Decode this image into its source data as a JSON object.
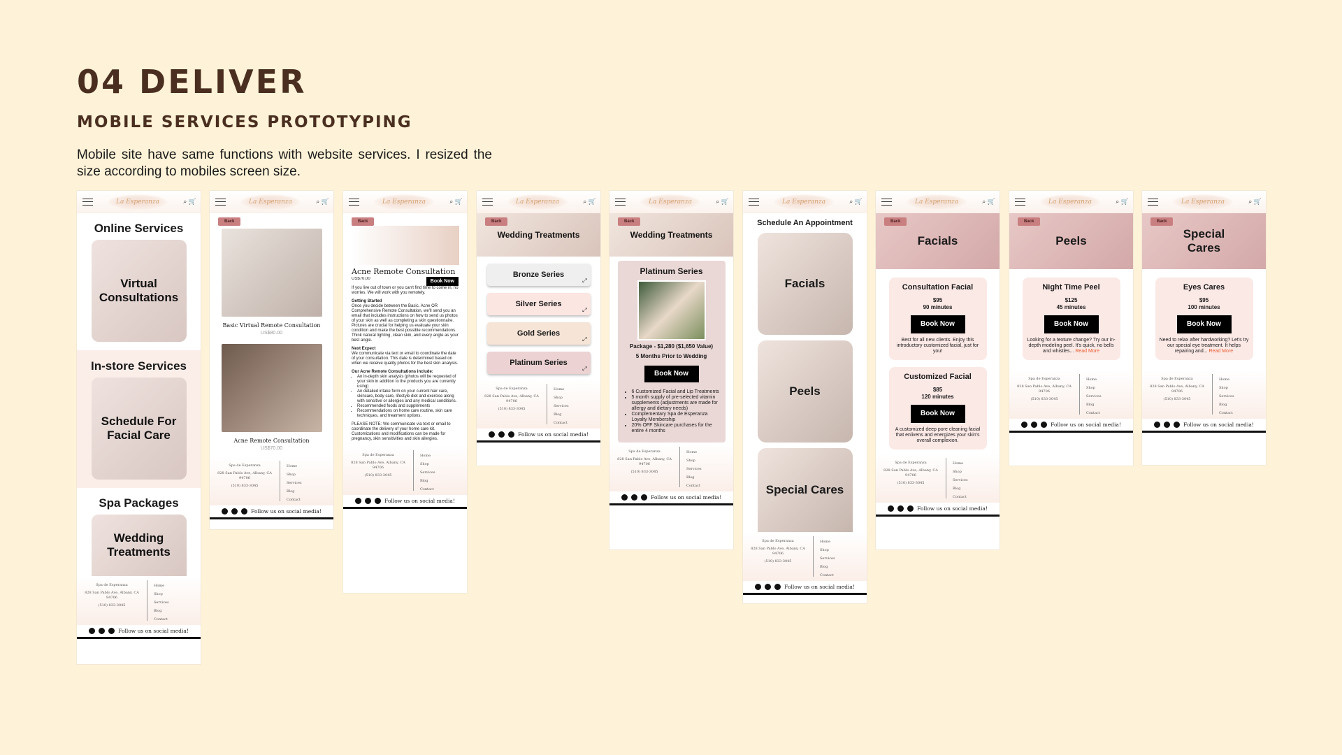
{
  "title": "04 DELIVER",
  "subtitle": "MOBILE SERVICES PROTOTYPING",
  "description": "Mobile site have same functions with website services. I resized the size according to mobiles screen size.",
  "common": {
    "logo": "La Esperanza",
    "back": "Back",
    "book_now": "Book Now",
    "footer_name": "Spa de Esperanza",
    "footer_addr": "828 San Pablo Ave, Albany, CA 94706",
    "footer_phone": "(510) 833-3045",
    "links": [
      "Home",
      "Shop",
      "Services",
      "Blog",
      "Contact"
    ],
    "social": "Follow us on social media!",
    "read_more": "Read More"
  },
  "p1": {
    "s1": "Online Services",
    "c1": "Virtual Consultations",
    "s2": "In-store Services",
    "c2": "Schedule For Facial Care",
    "s3": "Spa Packages",
    "c3": "Wedding Treatments"
  },
  "p2": {
    "cap1": "Basic Virtual Remote Consultation",
    "price1": "US$80.00",
    "cap2": "Acne Remote Consultation",
    "price2": "US$70.00"
  },
  "p3": {
    "title": "Acne Remote Consultation",
    "price": "US$70.00",
    "intro": "If you live out of town or you can't find time to come in, no worries. We will work with you remotely.",
    "h1": "Getting Started",
    "b1": "Once you decide between the Basic, Acne OR Comprehensive Remote Consultation, we'll send you an email that includes instructions on how to send us photos of your skin as well as completing a skin questionnaire. Pictures are crucial for helping us evaluate your skin condition and make the best possible recommendations. Think natural lighting, clean skin, and every angle as your best angle.",
    "h2": "Next Expect",
    "b2": "We communicate via text or email to coordinate the date of your consultation. This date is determined based on when we receive quality photos for the best skin analysis.",
    "h3": "Our Acne Remote Consultations include:",
    "items": [
      "An in-depth skin analysis (photos will be requested of your skin in addition to the products you are currently using)",
      "An detailed intake form on your current hair care, skincare, body care, lifestyle diet and exercise along with sensitive or allergies and any medical conditions.",
      "Recommended foods and supplements",
      "Recommendations on home care routine, skin care techniques, and treatment options."
    ],
    "note": "PLEASE NOTE: We communicate via text or email to coordinate the delivery of your home care kit. Customizations and modifications can be made for pregnancy, skin sensitivities and skin allergies."
  },
  "p4": {
    "banner": "Wedding Treatments",
    "series": [
      {
        "label": "Bronze Series",
        "color": "#efefef"
      },
      {
        "label": "Silver Series",
        "color": "#fbe6e2"
      },
      {
        "label": "Gold Series",
        "color": "#f6e4d6"
      },
      {
        "label": "Platinum Series",
        "color": "#ecd2d2"
      }
    ]
  },
  "p5": {
    "banner": "Wedding Treatments",
    "title": "Platinum Series",
    "package": "Package - $1,280  ($1,650 Value)",
    "timing": "5 Months Prior to Wedding",
    "items": [
      "6 Customized Facial and Lip Treatments",
      "5 month supply of pre-selected vitamin supplements (adjustments are made for allergy and dietary needs)",
      "Complementary Spa de Esperanza Loyalty Membership",
      "20% OFF Skincare purchases for the entire 4 months"
    ]
  },
  "p6": {
    "heading": "Schedule An Appointment",
    "cats": [
      "Facials",
      "Peels",
      "Special Cares"
    ]
  },
  "p7": {
    "banner": "Facials",
    "svcs": [
      {
        "name": "Consultation Facial",
        "price": "$95",
        "dur": "90 minutes",
        "desc": "Best for all new clients. Enjoy this introductory customized facial, just for you!"
      },
      {
        "name": "Customized Facial",
        "price": "$85",
        "dur": "120 minutes",
        "desc": "A customized deep pore cleaning facial that enlivens and energizes your skin's overall complexion."
      }
    ]
  },
  "p8": {
    "banner": "Peels",
    "name": "Night Time Peel",
    "price": "$125",
    "dur": "45 minutes",
    "desc": "Looking for a texture change? Try our in-depth modeling peel. It's quick, no bells and whistles..."
  },
  "p9": {
    "banner": "Special Cares",
    "name": "Eyes Cares",
    "price": "$95",
    "dur": "100 minutes",
    "desc": "Need to relax after hardworking? Let's try our special eye treatment. It helps repairing and..."
  }
}
